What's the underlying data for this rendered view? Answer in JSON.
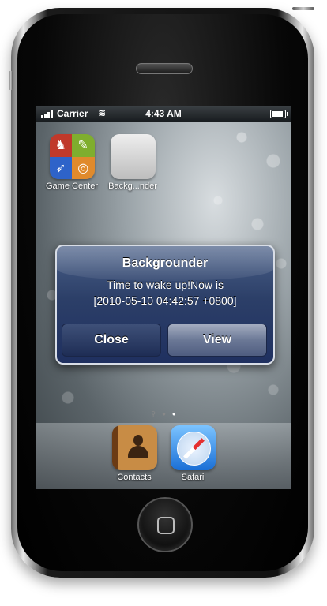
{
  "status_bar": {
    "carrier": "Carrier",
    "time": "4:43 AM",
    "battery_level": 0.9
  },
  "home_screen": {
    "apps": [
      {
        "label": "Game Center",
        "icon": "game-center-icon"
      },
      {
        "label": "Backg...nder",
        "icon": "backgrounder-app-icon"
      }
    ],
    "page_indicator": {
      "pages": 3,
      "current": 2
    },
    "dock": [
      {
        "label": "Contacts",
        "icon": "contacts-icon"
      },
      {
        "label": "Safari",
        "icon": "safari-compass-icon"
      }
    ]
  },
  "alert": {
    "title": "Backgrounder",
    "message_line1": "Time to wake up!Now is",
    "message_line2": "[2010-05-10 04:42:57 +0800]",
    "buttons": {
      "close": "Close",
      "view": "View"
    }
  },
  "device": {
    "hardware_home_button": "home-button"
  },
  "colors": {
    "alert_blue": "#2c3f68",
    "status_bar": "#181c1f"
  }
}
